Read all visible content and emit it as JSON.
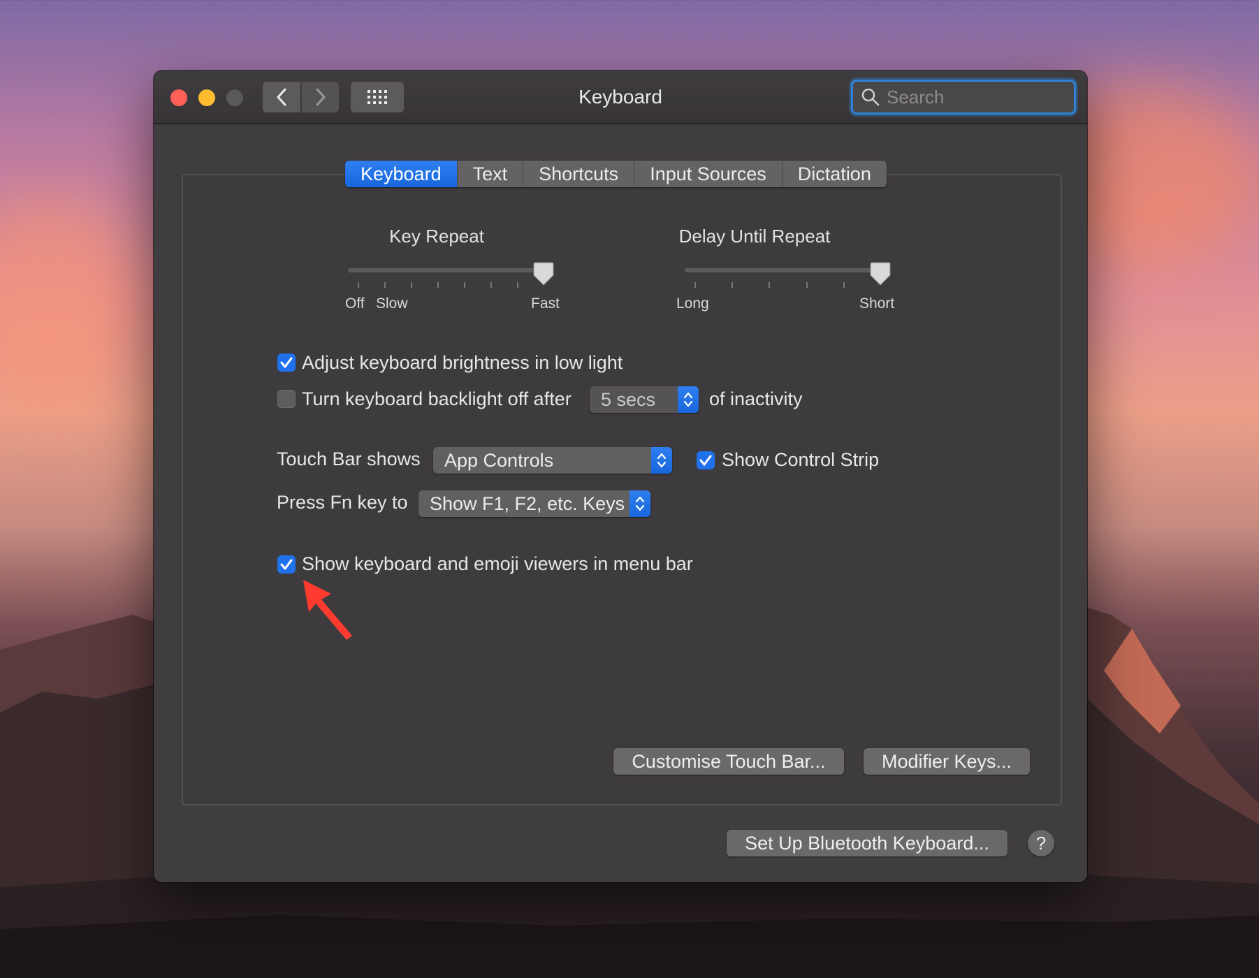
{
  "window": {
    "title": "Keyboard"
  },
  "toolbar": {
    "back_icon": "chevron-left-icon",
    "forward_icon": "chevron-right-icon",
    "grid_icon": "grid-icon",
    "search_placeholder": "Search"
  },
  "tabs": [
    {
      "label": "Keyboard",
      "active": true
    },
    {
      "label": "Text",
      "active": false
    },
    {
      "label": "Shortcuts",
      "active": false
    },
    {
      "label": "Input Sources",
      "active": false
    },
    {
      "label": "Dictation",
      "active": false
    }
  ],
  "key_repeat": {
    "title": "Key Repeat",
    "labels": {
      "off": "Off",
      "slow": "Slow",
      "fast": "Fast"
    },
    "value_fraction": 1.0
  },
  "delay_until_repeat": {
    "title": "Delay Until Repeat",
    "labels": {
      "long": "Long",
      "short": "Short"
    },
    "value_fraction": 1.0
  },
  "options": {
    "adjust_brightness": {
      "label": "Adjust keyboard brightness in low light",
      "checked": true
    },
    "backlight_off": {
      "label": "Turn keyboard backlight off after",
      "checked": false,
      "value": "5 secs",
      "suffix": "of inactivity"
    },
    "touch_bar": {
      "label": "Touch Bar shows",
      "value": "App Controls"
    },
    "control_strip": {
      "label": "Show Control Strip",
      "checked": true
    },
    "fn_key": {
      "label": "Press Fn key to",
      "value": "Show F1, F2, etc. Keys"
    },
    "emoji_viewers": {
      "label": "Show keyboard and emoji viewers in menu bar",
      "checked": true
    }
  },
  "buttons": {
    "customise_touch_bar": "Customise Touch Bar...",
    "modifier_keys": "Modifier Keys...",
    "bluetooth": "Set Up Bluetooth Keyboard...",
    "help": "?"
  },
  "colors": {
    "accent": "#1f72ec",
    "close": "#fe5f57",
    "minimize": "#febc2e",
    "zoom_disabled": "#5b585b",
    "annotation_arrow": "#ff3b2f"
  }
}
